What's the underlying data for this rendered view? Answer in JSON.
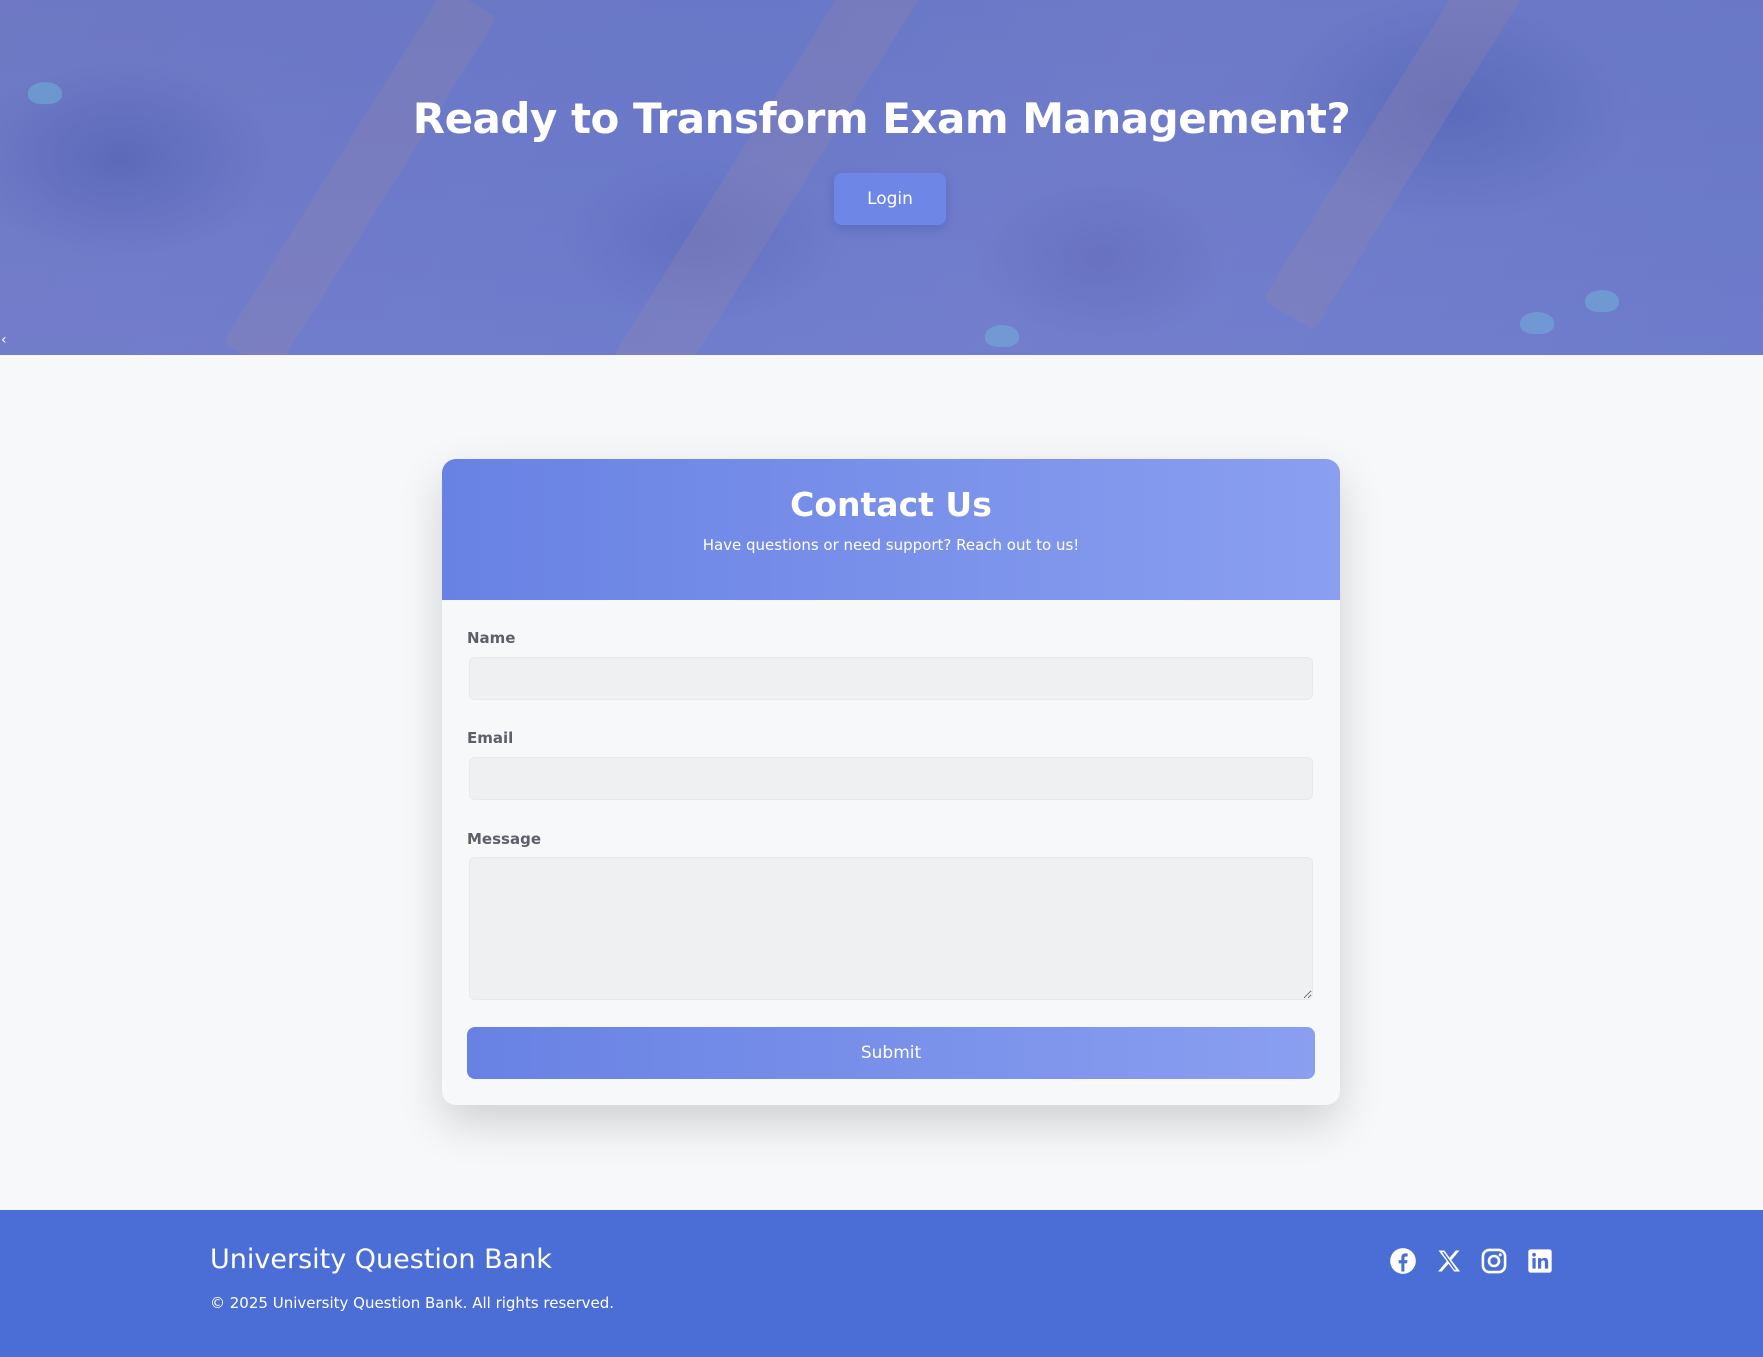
{
  "hero": {
    "title": "Ready to Transform Exam Management?",
    "login_label": "Login",
    "chevron": "‹"
  },
  "contact": {
    "title": "Contact Us",
    "subtitle": "Have questions or need support? Reach out to us!",
    "fields": [
      {
        "label": "Name",
        "value": "",
        "placeholder": ""
      },
      {
        "label": "Email",
        "value": "",
        "placeholder": ""
      },
      {
        "label": "Message",
        "value": "",
        "placeholder": ""
      }
    ],
    "submit_label": "Submit"
  },
  "footer": {
    "brand": "University Question Bank",
    "copyright": "© 2025 University Question Bank. All rights reserved.",
    "social": [
      "facebook-icon",
      "x-icon",
      "instagram-icon",
      "linkedin-icon"
    ]
  },
  "colors": {
    "primary": "#4b6dd6",
    "accent_gradient_start": "#6882e4",
    "accent_gradient_end": "#8a9ff0",
    "page_background": "#f7f8fa",
    "input_background": "#eff0f2"
  }
}
